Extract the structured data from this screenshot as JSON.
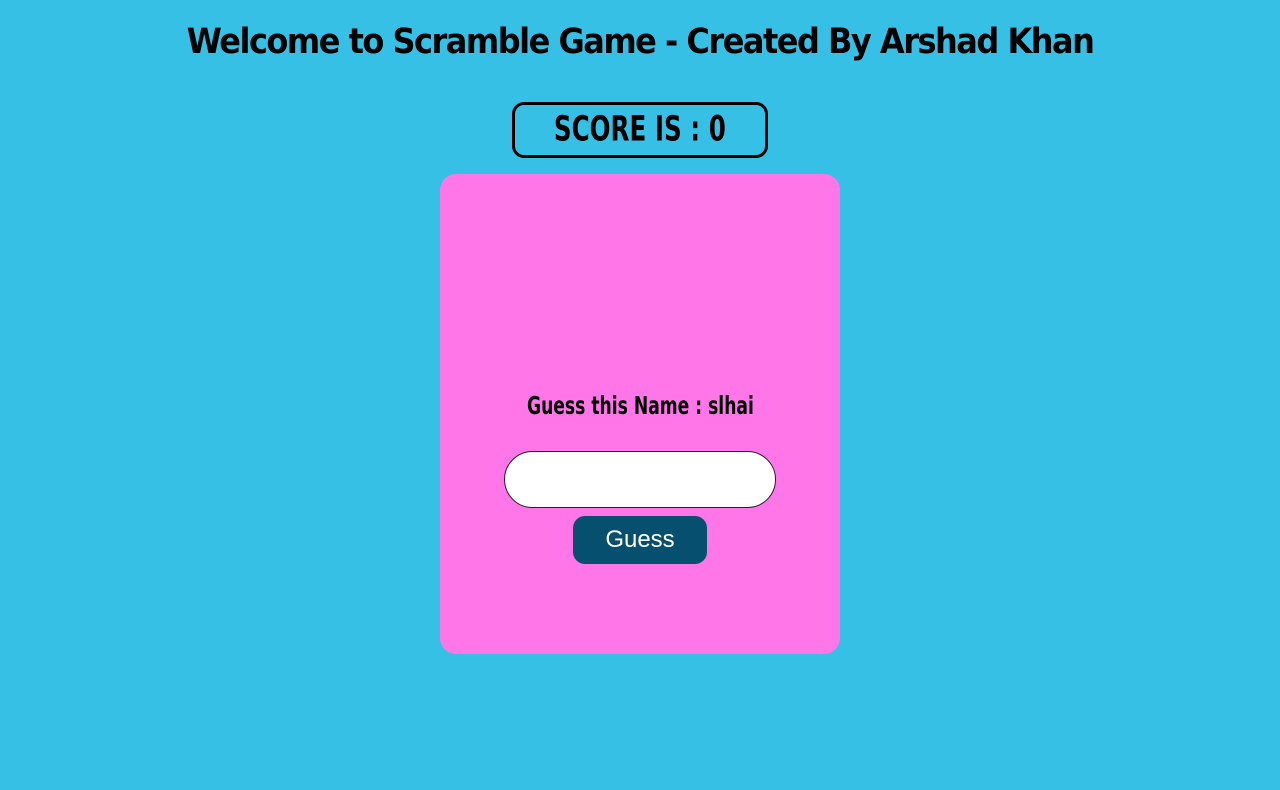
{
  "header": {
    "title": "Welcome to Scramble Game - Created By Arshad Khan"
  },
  "score": {
    "label": "SCORE IS : 0"
  },
  "game": {
    "question": "Guess this Name : slhai",
    "input_value": "",
    "input_placeholder": "",
    "guess_label": "Guess"
  },
  "colors": {
    "background": "#36c0e5",
    "card": "#ff76e9",
    "button": "#064f6e"
  }
}
